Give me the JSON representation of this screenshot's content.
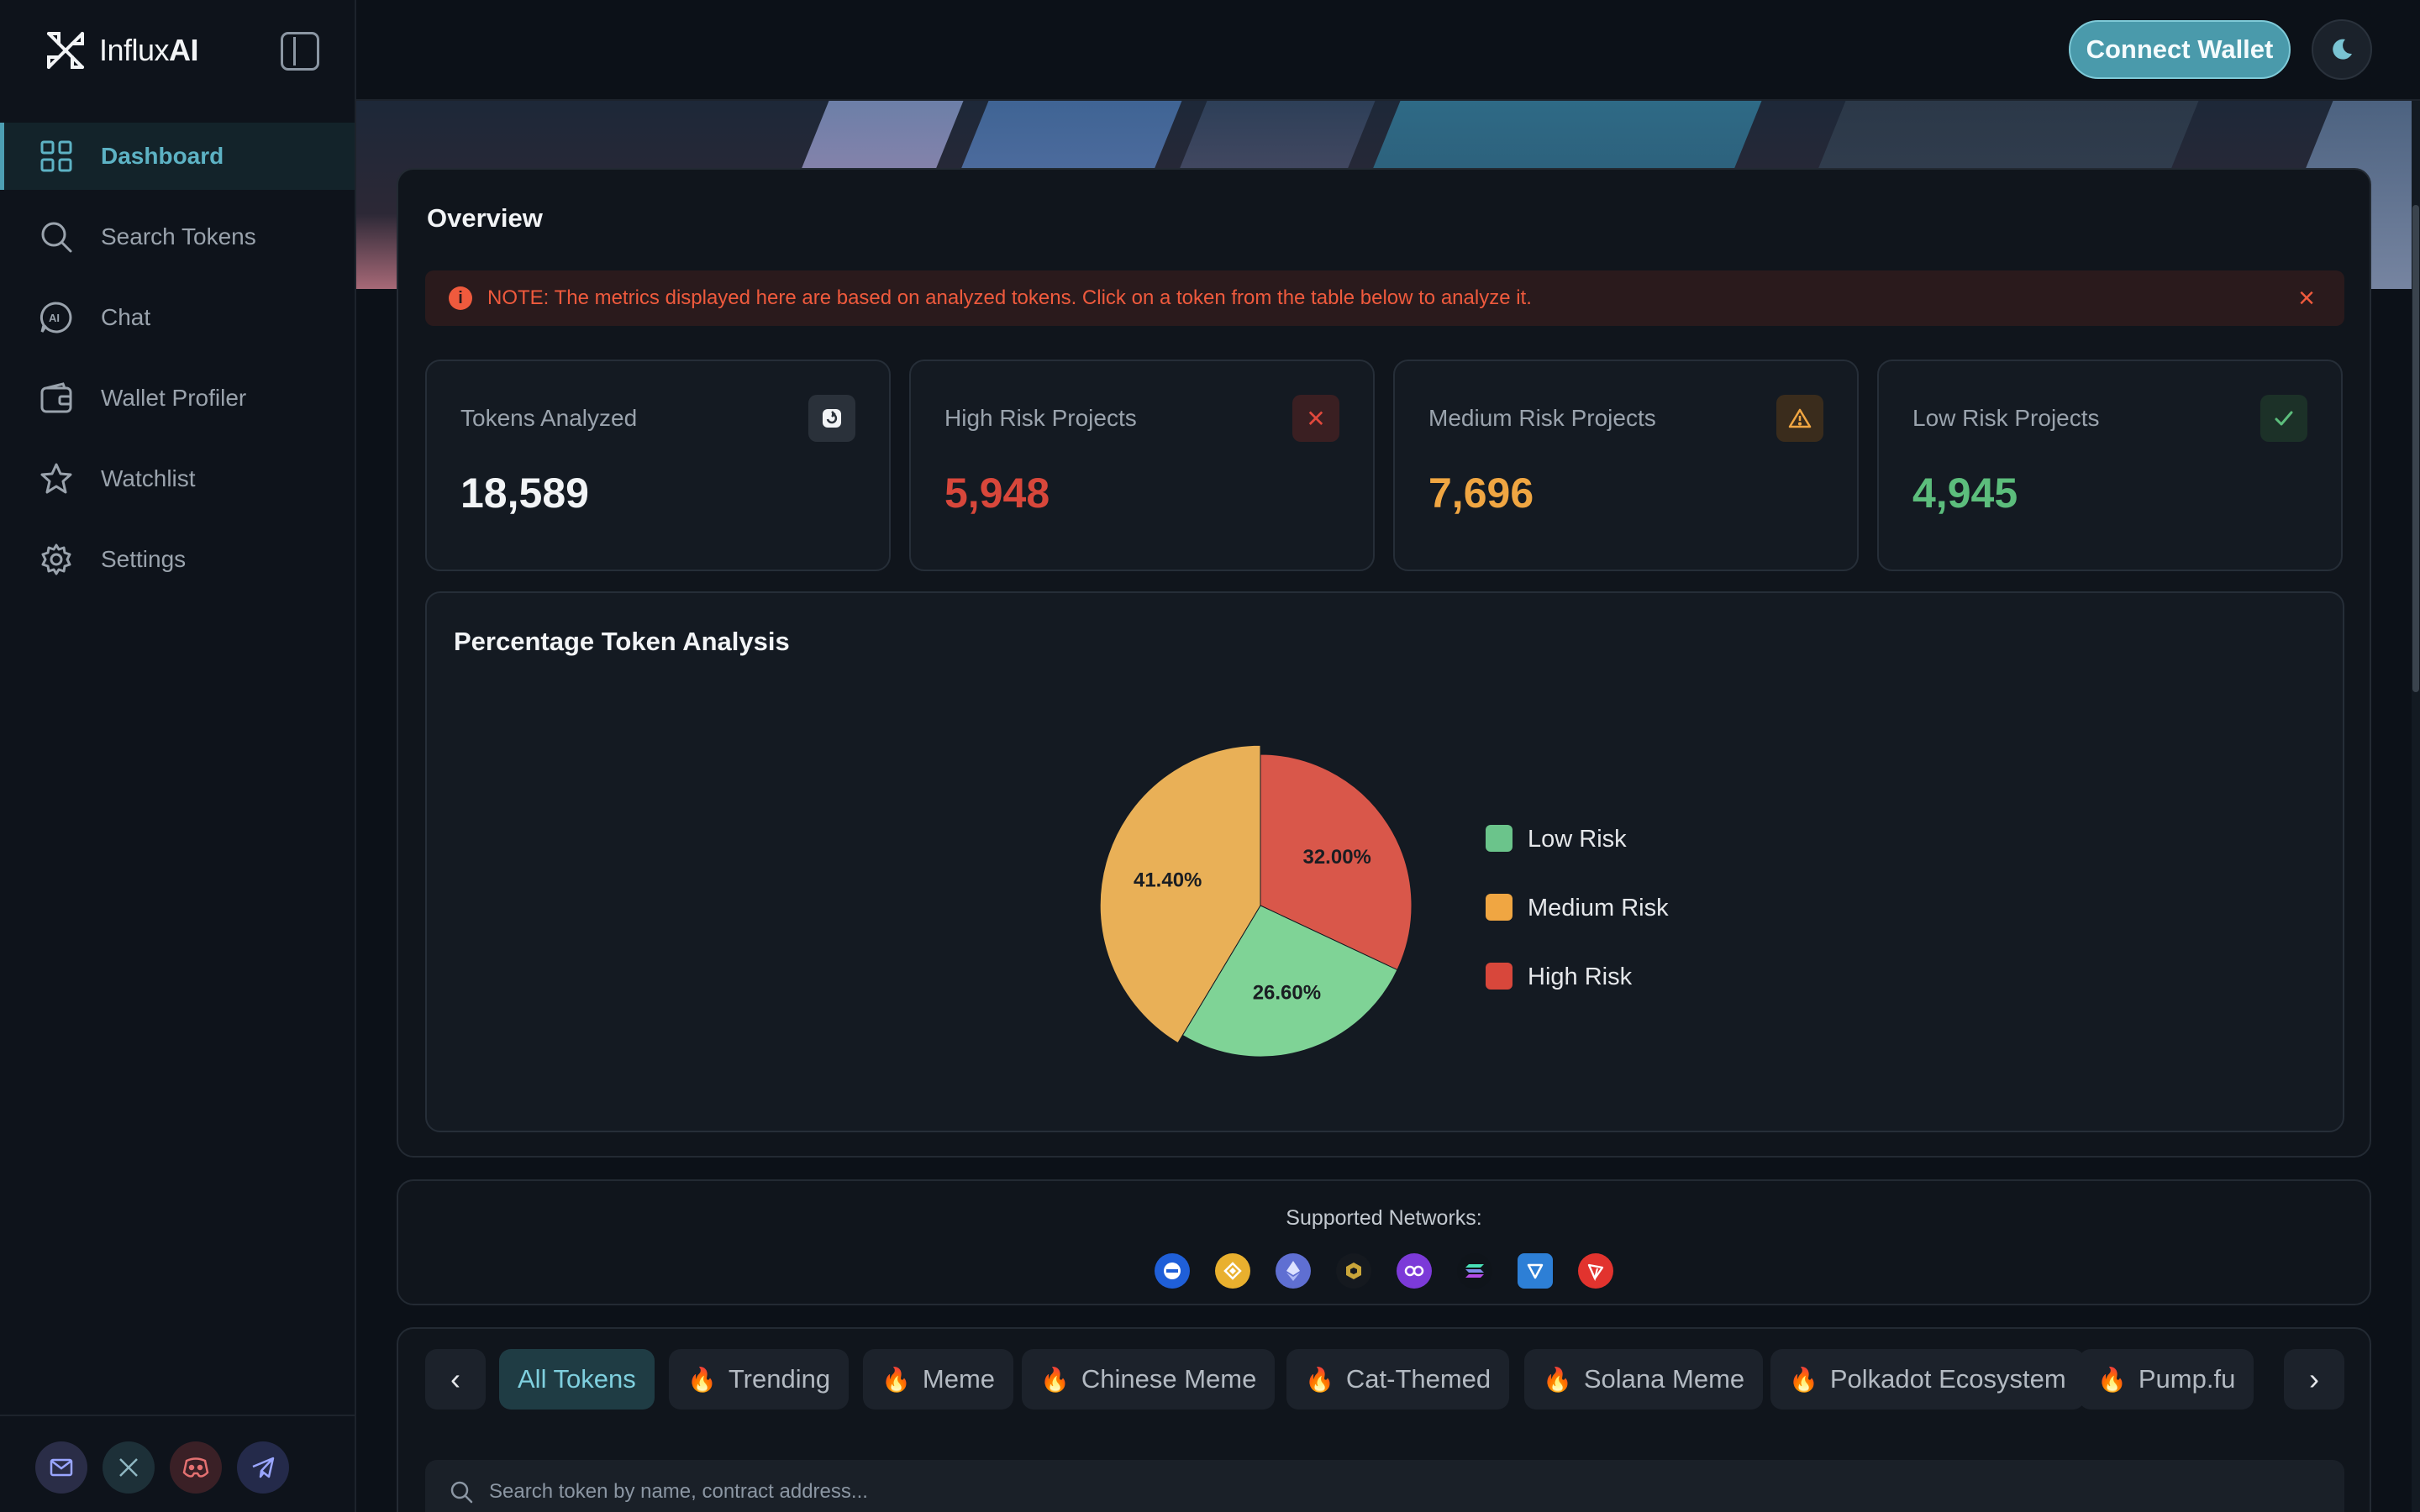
{
  "brand": {
    "name_light": "Influx",
    "name_bold": "AI"
  },
  "sidebar": {
    "items": [
      {
        "label": "Dashboard",
        "icon": "grid-icon"
      },
      {
        "label": "Search Tokens",
        "icon": "search-icon"
      },
      {
        "label": "Chat",
        "icon": "ai-chat-icon"
      },
      {
        "label": "Wallet Profiler",
        "icon": "wallet-icon"
      },
      {
        "label": "Watchlist",
        "icon": "star-icon"
      },
      {
        "label": "Settings",
        "icon": "gear-icon"
      }
    ],
    "active_index": 0,
    "social": [
      "mail-icon",
      "x-icon",
      "discord-icon",
      "telegram-icon"
    ]
  },
  "topbar": {
    "connect_label": "Connect Wallet",
    "theme_icon": "moon-icon"
  },
  "overview": {
    "title": "Overview",
    "note": "NOTE: The metrics displayed here are based on analyzed tokens. Click on a token from the table below to analyze it.",
    "stats": [
      {
        "label": "Tokens Analyzed",
        "value": "18,589",
        "color": "#f2f4f6",
        "icon": "refresh-icon"
      },
      {
        "label": "High Risk Projects",
        "value": "5,948",
        "color": "#d8473b",
        "icon": "x-mark-icon"
      },
      {
        "label": "Medium Risk Projects",
        "value": "7,696",
        "color": "#f0a642",
        "icon": "warning-icon"
      },
      {
        "label": "Low Risk Projects",
        "value": "4,945",
        "color": "#5cbd7c",
        "icon": "check-icon"
      }
    ]
  },
  "chart_data": {
    "type": "pie",
    "title": "Percentage Token Analysis",
    "slices": [
      {
        "label": "High Risk",
        "value": 32.0,
        "display": "32.00%",
        "color": "#d9574a"
      },
      {
        "label": "Low Risk",
        "value": 26.6,
        "display": "26.60%",
        "color": "#7fd396"
      },
      {
        "label": "Medium Risk",
        "value": 41.4,
        "display": "41.40%",
        "color": "#e9b057"
      }
    ],
    "legend": [
      {
        "label": "Low Risk",
        "color": "#6bc48b"
      },
      {
        "label": "Medium Risk",
        "color": "#f0a642"
      },
      {
        "label": "High Risk",
        "color": "#d8473b"
      }
    ],
    "legend_position": "right"
  },
  "networks": {
    "label": "Supported Networks:",
    "icons": [
      "ton-icon",
      "bnb-icon",
      "ethereum-icon",
      "bnb-greenfield-icon",
      "polygon-icon",
      "solana-icon",
      "tron-shield-icon",
      "tron-icon"
    ]
  },
  "tabs": {
    "items": [
      "All Tokens",
      "Trending",
      "Meme",
      "Chinese Meme",
      "Cat-Themed",
      "Solana Meme",
      "Polkadot Ecosystem",
      "Pump.fu"
    ],
    "active_index": 0
  },
  "search": {
    "placeholder": "Search token by name, contract address..."
  }
}
